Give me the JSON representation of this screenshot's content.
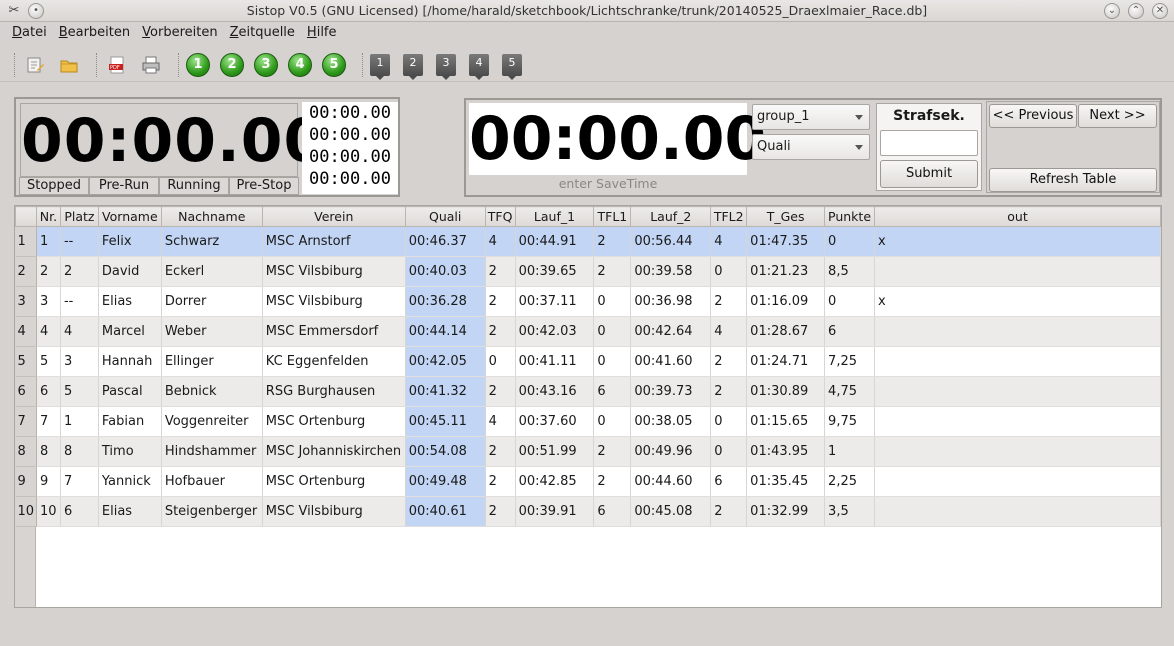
{
  "window": {
    "title": "Sistop V0.5 (GNU Licensed) [/home/harald/sketchbook/Lichtschranke/trunk/20140525_Draexlmaier_Race.db]"
  },
  "menu": [
    "Datei",
    "Bearbeiten",
    "Vorbereiten",
    "Zeitquelle",
    "Hilfe"
  ],
  "toolbar": {
    "green_buttons": [
      "1",
      "2",
      "3",
      "4",
      "5"
    ],
    "gray_buttons": [
      "1",
      "2",
      "3",
      "4",
      "5"
    ]
  },
  "clock_left": {
    "time": "00:00.00",
    "laps": [
      "00:00.00",
      "00:00.00",
      "00:00.00",
      "00:00.00"
    ],
    "states": [
      "Stopped",
      "Pre-Run",
      "Running",
      "Pre-Stop"
    ]
  },
  "clock_right": {
    "time": "00:00.00",
    "savetime_placeholder": "enter SaveTime",
    "group_value": "group_1",
    "mode_value": "Quali",
    "straf_label": "Strafsek.",
    "submit_label": "Submit",
    "previous_label": "<< Previous",
    "next_label": "Next >>",
    "refresh_label": "Refresh Table"
  },
  "table": {
    "columns": [
      "Nr.",
      "Platz",
      "Vorname",
      "Nachname",
      "Verein",
      "Quali",
      "TFQ",
      "Lauf_1",
      "TFL1",
      "Lauf_2",
      "TFL2",
      "T_Ges",
      "Punkte",
      "out"
    ],
    "rows": [
      [
        "1",
        "1",
        "--",
        "Felix",
        "Schwarz",
        "MSC Arnstorf",
        "00:46.37",
        "4",
        "00:44.91",
        "2",
        "00:56.44",
        "4",
        "01:47.35",
        "0",
        "x"
      ],
      [
        "2",
        "2",
        "2",
        "David",
        "Eckerl",
        "MSC Vilsbiburg",
        "00:40.03",
        "2",
        "00:39.65",
        "2",
        "00:39.58",
        "0",
        "01:21.23",
        "8,5",
        ""
      ],
      [
        "3",
        "3",
        "--",
        "Elias",
        "Dorrer",
        "MSC Vilsbiburg",
        "00:36.28",
        "2",
        "00:37.11",
        "0",
        "00:36.98",
        "2",
        "01:16.09",
        "0",
        "x"
      ],
      [
        "4",
        "4",
        "4",
        "Marcel",
        "Weber",
        "MSC Emmersdorf",
        "00:44.14",
        "2",
        "00:42.03",
        "0",
        "00:42.64",
        "4",
        "01:28.67",
        "6",
        ""
      ],
      [
        "5",
        "5",
        "3",
        "Hannah",
        "Ellinger",
        "KC Eggenfelden",
        "00:42.05",
        "0",
        "00:41.11",
        "0",
        "00:41.60",
        "2",
        "01:24.71",
        "7,25",
        ""
      ],
      [
        "6",
        "6",
        "5",
        "Pascal",
        "Bebnick",
        "RSG Burghausen",
        "00:41.32",
        "2",
        "00:43.16",
        "6",
        "00:39.73",
        "2",
        "01:30.89",
        "4,75",
        ""
      ],
      [
        "7",
        "7",
        "1",
        "Fabian",
        "Voggenreiter",
        "MSC Ortenburg",
        "00:45.11",
        "4",
        "00:37.60",
        "0",
        "00:38.05",
        "0",
        "01:15.65",
        "9,75",
        ""
      ],
      [
        "8",
        "8",
        "8",
        "Timo",
        "Hindshammer",
        "MSC Johanniskirchen",
        "00:54.08",
        "2",
        "00:51.99",
        "2",
        "00:49.96",
        "0",
        "01:43.95",
        "1",
        ""
      ],
      [
        "9",
        "9",
        "7",
        "Yannick",
        "Hofbauer",
        "MSC Ortenburg",
        "00:49.48",
        "2",
        "00:42.85",
        "2",
        "00:44.60",
        "6",
        "01:35.45",
        "2,25",
        ""
      ],
      [
        "10",
        "10",
        "6",
        "Elias",
        "Steigenberger",
        "MSC Vilsbiburg",
        "00:40.61",
        "2",
        "00:39.91",
        "6",
        "00:45.08",
        "2",
        "01:32.99",
        "3,5",
        ""
      ]
    ]
  }
}
